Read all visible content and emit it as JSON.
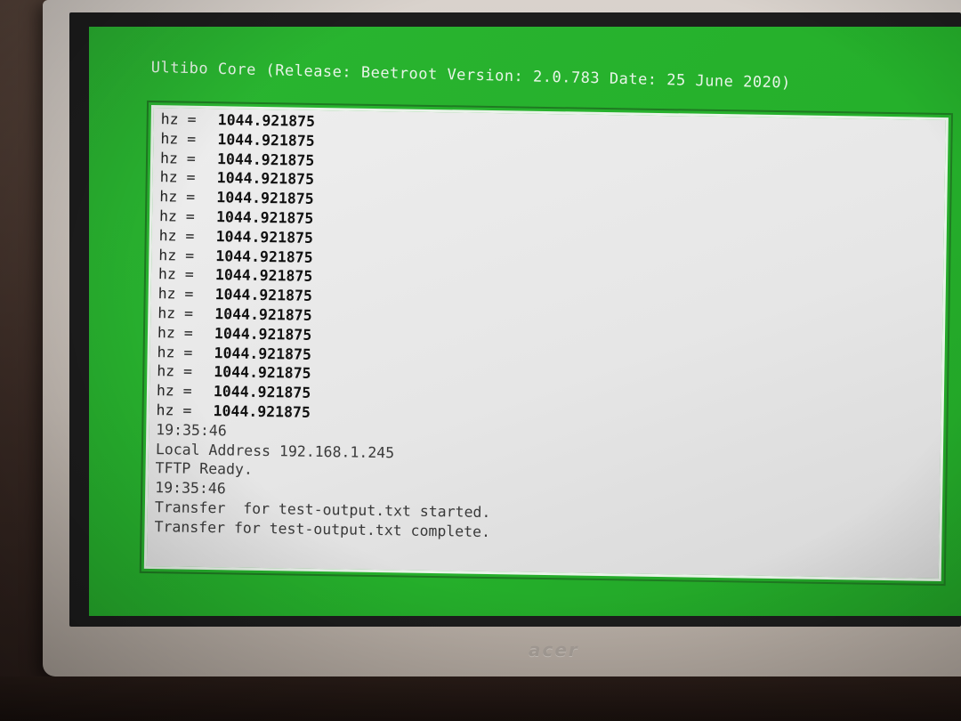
{
  "screen": {
    "title": "Ultibo Core (Release: Beetroot Version: 2.0.783 Date: 25 June 2020)"
  },
  "console": {
    "hz_lines": [
      {
        "label": "hz =",
        "value": "1044.921875"
      },
      {
        "label": "hz =",
        "value": "1044.921875"
      },
      {
        "label": "hz =",
        "value": "1044.921875"
      },
      {
        "label": "hz =",
        "value": "1044.921875"
      },
      {
        "label": "hz =",
        "value": "1044.921875"
      },
      {
        "label": "hz =",
        "value": "1044.921875"
      },
      {
        "label": "hz =",
        "value": "1044.921875"
      },
      {
        "label": "hz =",
        "value": "1044.921875"
      },
      {
        "label": "hz =",
        "value": "1044.921875"
      },
      {
        "label": "hz =",
        "value": "1044.921875"
      },
      {
        "label": "hz =",
        "value": "1044.921875"
      },
      {
        "label": "hz =",
        "value": "1044.921875"
      },
      {
        "label": "hz =",
        "value": "1044.921875"
      },
      {
        "label": "hz =",
        "value": "1044.921875"
      },
      {
        "label": "hz =",
        "value": "1044.921875"
      },
      {
        "label": "hz =",
        "value": "1044.921875"
      }
    ],
    "log_lines": [
      "19:35:46",
      "Local Address 192.168.1.245",
      "TFTP Ready.",
      "19:35:46",
      "Transfer  for test-output.txt started.",
      "Transfer for test-output.txt complete."
    ]
  },
  "monitor": {
    "brand": "acer"
  },
  "colors": {
    "screen_green": "#25b02b",
    "console_bg": "#e6e6e6"
  }
}
